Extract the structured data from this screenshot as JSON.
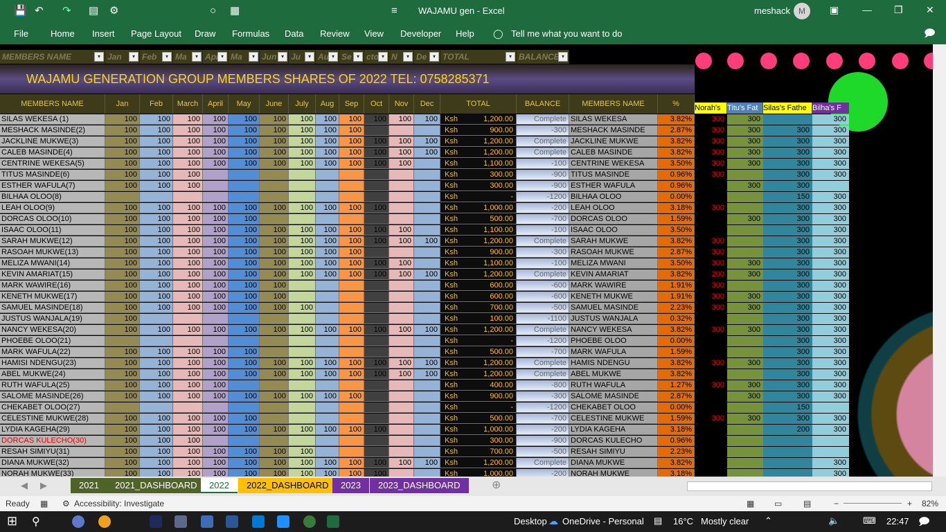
{
  "window": {
    "title": "WAJAMU gen  -  Excel",
    "user": "meshack",
    "avatar": "M"
  },
  "ribbon_tabs": [
    "File",
    "Home",
    "Insert",
    "Page Layout",
    "Draw",
    "Formulas",
    "Data",
    "Review",
    "View",
    "Developer",
    "Help",
    "Tell me what you want to do"
  ],
  "filter_headers": [
    "MEMBERS  NAME",
    "Jan",
    "Feb",
    "Ma",
    "Apr",
    "Ma",
    "Jun",
    "Ju",
    "Au",
    "Se",
    "cto",
    "N",
    "De",
    "TOTAL",
    "BALANCE"
  ],
  "banner": "WAJAMU GENERATION GROUP MEMBERS SHARES OF 2022  TEL: 0758285371",
  "col_headers": [
    "MEMBERS  NAME",
    "Jan",
    "Feb",
    "March",
    "April",
    "May",
    "June",
    "July",
    "Aug",
    "Sep",
    "Oct",
    "Nov",
    "Dec",
    "TOTAL",
    "BALANCE",
    "MEMBERS  NAME",
    "%",
    "Norah's",
    "Titu's Fat",
    "Silas's Fathe",
    "Bilha's F"
  ],
  "colors": {
    "ribbon": "#1e6c3e",
    "banner_text": "#ffd700",
    "dot": "#ff3c7c"
  },
  "rows": [
    {
      "n": "SILAS  WEKESA (1)",
      "m": [
        100,
        100,
        100,
        100,
        100,
        100,
        100,
        100,
        100,
        100,
        100,
        100
      ],
      "t": "1,200.00",
      "b": "Complete",
      "n2": "SILAS      WEKESA",
      "p": "3.82%",
      "x": [
        300,
        300,
        "",
        300
      ]
    },
    {
      "n": "MESHACK  MASINDE(2)",
      "m": [
        100,
        100,
        100,
        100,
        100,
        100,
        100,
        100,
        100,
        "",
        "",
        ""
      ],
      "t": "900.00",
      "b": "-300",
      "n2": "MESHACK   MASINDE",
      "p": "2.87%",
      "x": [
        300,
        300,
        300,
        300
      ]
    },
    {
      "n": "JACKLINE  MUKWE(3)",
      "m": [
        100,
        100,
        100,
        100,
        100,
        100,
        100,
        100,
        100,
        100,
        100,
        100
      ],
      "t": "1,200.00",
      "b": "Complete",
      "n2": "JACKLINE    MUKWE",
      "p": "3.82%",
      "x": [
        300,
        300,
        300,
        300
      ]
    },
    {
      "n": "CALEB   MASINDE(4)",
      "m": [
        100,
        100,
        100,
        100,
        100,
        100,
        100,
        100,
        100,
        100,
        100,
        100
      ],
      "t": "1,200.00",
      "b": "Complete",
      "n2": "CALEB    MASINDE",
      "p": "3.82%",
      "x": [
        300,
        300,
        300,
        300
      ]
    },
    {
      "n": "CENTRINE  WEKESA(5)",
      "m": [
        100,
        100,
        100,
        100,
        100,
        100,
        100,
        100,
        100,
        100,
        100,
        ""
      ],
      "t": "1,100.00",
      "b": "-100",
      "n2": "CENTRINE    WEKESA",
      "p": "3.50%",
      "x": [
        300,
        300,
        300,
        300
      ]
    },
    {
      "n": "TITUS  MASINDE(6)",
      "m": [
        100,
        100,
        100,
        "",
        "",
        "",
        "",
        "",
        "",
        "",
        "",
        ""
      ],
      "t": "300.00",
      "b": "-900",
      "n2": "TITUS          MASINDE",
      "p": "0.96%",
      "x": [
        300,
        "",
        300,
        300
      ]
    },
    {
      "n": "ESTHER  WAFULA(7)",
      "m": [
        100,
        100,
        100,
        "",
        "",
        "",
        "",
        "",
        "",
        "",
        "",
        ""
      ],
      "t": "300.00",
      "b": "-900",
      "n2": "ESTHER  WAFULA",
      "p": "0.96%",
      "x": [
        "",
        300,
        300,
        ""
      ]
    },
    {
      "n": "BILHAA OLOO(8)",
      "m": [
        "",
        "",
        "",
        "",
        "",
        "",
        "",
        "",
        "",
        "",
        "",
        ""
      ],
      "t": "-",
      "b": "-1200",
      "n2": "BILHAA    OLOO",
      "p": "0.00%",
      "x": [
        "",
        "",
        150,
        300
      ]
    },
    {
      "n": "LEAH OLOO(9)",
      "m": [
        100,
        100,
        100,
        100,
        100,
        100,
        100,
        100,
        100,
        100,
        "",
        ""
      ],
      "t": "1,000.00",
      "b": "-200",
      "n2": "LEAH        OLOO",
      "p": "3.18%",
      "x": [
        300,
        "",
        300,
        300
      ]
    },
    {
      "n": "DORCAS OLOO(10)",
      "m": [
        100,
        100,
        100,
        100,
        100,
        "",
        "",
        "",
        "",
        "",
        "",
        ""
      ],
      "t": "500.00",
      "b": "-700",
      "n2": "DORCAS    OLOO",
      "p": "1.59%",
      "x": [
        "",
        300,
        300,
        300
      ]
    },
    {
      "n": "ISAAC OLOO(11)",
      "m": [
        100,
        100,
        100,
        100,
        100,
        100,
        100,
        100,
        100,
        100,
        100,
        ""
      ],
      "t": "1,100.00",
      "b": "-100",
      "n2": "ISAAC     OLOO",
      "p": "3.50%",
      "x": [
        "",
        "",
        300,
        300
      ]
    },
    {
      "n": "SARAH  MUKWE(12)",
      "m": [
        100,
        100,
        100,
        100,
        100,
        100,
        100,
        100,
        100,
        100,
        100,
        100
      ],
      "t": "1,200.00",
      "b": "Complete",
      "n2": "SARAH     MUKWE",
      "p": "3.82%",
      "x": [
        300,
        "",
        300,
        300
      ]
    },
    {
      "n": "RASOAH MUKWE(13)",
      "m": [
        100,
        100,
        100,
        100,
        100,
        100,
        100,
        100,
        100,
        "",
        "",
        ""
      ],
      "t": "900.00",
      "b": "-300",
      "n2": "RASOAH     MUKWE",
      "p": "2.87%",
      "x": [
        300,
        "",
        300,
        300
      ]
    },
    {
      "n": "MELIZA MWANI(14)",
      "m": [
        100,
        100,
        100,
        100,
        100,
        100,
        100,
        100,
        100,
        100,
        100,
        ""
      ],
      "t": "1,100.00",
      "b": "-100",
      "n2": "MELIZA      MWANI",
      "p": "3.50%",
      "x": [
        300,
        300,
        300,
        300
      ]
    },
    {
      "n": "KEVIN AMARIAT(15)",
      "m": [
        100,
        100,
        100,
        100,
        100,
        100,
        100,
        100,
        100,
        100,
        100,
        100
      ],
      "t": "1,200.00",
      "b": "Complete",
      "n2": "KEVIN      AMARIAT",
      "p": "3.82%",
      "x": [
        200,
        300,
        300,
        300
      ]
    },
    {
      "n": "MARK  WAWIRE(16)",
      "m": [
        100,
        100,
        100,
        100,
        100,
        100,
        "",
        "",
        "",
        "",
        "",
        ""
      ],
      "t": "600.00",
      "b": "-600",
      "n2": "MARK      WAWIRE",
      "p": "1.91%",
      "x": [
        300,
        "",
        300,
        300
      ]
    },
    {
      "n": "KENETH  MUKWE(17)",
      "m": [
        100,
        100,
        100,
        100,
        100,
        100,
        "",
        "",
        "",
        "",
        "",
        ""
      ],
      "t": "600.00",
      "b": "-600",
      "n2": "KENETH      MUKWE",
      "p": "1.91%",
      "x": [
        300,
        300,
        300,
        300
      ]
    },
    {
      "n": "SAMUEL MASINDE(18)",
      "m": [
        100,
        100,
        100,
        100,
        100,
        100,
        100,
        "",
        "",
        "",
        "",
        ""
      ],
      "t": "700.00",
      "b": "-500",
      "n2": "SAMUEL     MASINDE",
      "p": "2.23%",
      "x": [
        300,
        300,
        300,
        300
      ]
    },
    {
      "n": "JUSTUS  WANJALA(19)",
      "m": [
        100,
        "",
        "",
        "",
        "",
        "",
        "",
        "",
        "",
        "",
        "",
        ""
      ],
      "t": "100.00",
      "b": "-1100",
      "n2": "JUSTUS  WANJALA",
      "p": "0.32%",
      "x": [
        "",
        "",
        300,
        300
      ]
    },
    {
      "n": "NANCY  WEKESA(20)",
      "m": [
        100,
        100,
        100,
        100,
        100,
        100,
        100,
        100,
        100,
        100,
        100,
        100
      ],
      "t": "1,200.00",
      "b": "Complete",
      "n2": "NANCY  WEKESA",
      "p": "3.82%",
      "x": [
        300,
        300,
        300,
        300
      ]
    },
    {
      "n": "PHOEBE  OLOO(21)",
      "m": [
        "",
        "",
        "",
        "",
        "",
        "",
        "",
        "",
        "",
        "",
        "",
        ""
      ],
      "t": "-",
      "b": "-1200",
      "n2": "PHOEBE  OLOO",
      "p": "0.00%",
      "x": [
        "",
        "",
        300,
        300
      ]
    },
    {
      "n": "MARK   WAFULA(22)",
      "m": [
        100,
        100,
        100,
        100,
        100,
        "",
        "",
        "",
        "",
        "",
        "",
        ""
      ],
      "t": "500.00",
      "b": "-700",
      "n2": "MARK  WAFULA",
      "p": "1.59%",
      "x": [
        "",
        "",
        300,
        300
      ]
    },
    {
      "n": "HAMISI  NDENGU(23)",
      "m": [
        100,
        100,
        100,
        100,
        100,
        100,
        100,
        100,
        100,
        100,
        100,
        100
      ],
      "t": "1,200.00",
      "b": "Complete",
      "n2": "HAMIS  NDENGU",
      "p": "3.82%",
      "x": [
        300,
        300,
        300,
        300
      ]
    },
    {
      "n": "ABEL  MUKWE(24)",
      "m": [
        100,
        100,
        100,
        100,
        100,
        100,
        100,
        100,
        100,
        100,
        100,
        100
      ],
      "t": "1,200.00",
      "b": "Complete",
      "n2": "ABEL  MUKWE",
      "p": "3.82%",
      "x": [
        "",
        "",
        300,
        300
      ]
    },
    {
      "n": "RUTH   WAFULA(25)",
      "m": [
        100,
        100,
        100,
        100,
        "",
        "",
        "",
        "",
        "",
        "",
        "",
        ""
      ],
      "t": "400.00",
      "b": "-800",
      "n2": "RUTH   WAFULA",
      "p": "1.27%",
      "x": [
        300,
        300,
        300,
        300
      ]
    },
    {
      "n": "SALOME  MASINDE(26)",
      "m": [
        100,
        100,
        100,
        100,
        100,
        100,
        100,
        100,
        100,
        "",
        "",
        ""
      ],
      "t": "900.00",
      "b": "-300",
      "n2": "SALOME  MASINDE",
      "p": "2.87%",
      "x": [
        "",
        300,
        300,
        300
      ]
    },
    {
      "n": "CHEKABET  OLOO(27)",
      "m": [
        "",
        "",
        "",
        "",
        "",
        "",
        "",
        "",
        "",
        "",
        "",
        ""
      ],
      "t": "-",
      "b": "-1200",
      "n2": "CHEKABET  OLOO",
      "p": "0.00%",
      "x": [
        "",
        "",
        150,
        ""
      ]
    },
    {
      "n": "CELESTINE  MUKWE(28)",
      "m": [
        100,
        100,
        100,
        100,
        100,
        "",
        "",
        "",
        "",
        "",
        "",
        ""
      ],
      "t": "500.00",
      "b": "-700",
      "n2": "CELESTINE  MUKWE",
      "p": "1.59%",
      "x": [
        300,
        300,
        300,
        300
      ]
    },
    {
      "n": "LYDIA  KAGEHA(29)",
      "m": [
        100,
        100,
        100,
        100,
        100,
        100,
        100,
        100,
        100,
        100,
        "",
        ""
      ],
      "t": "1,000.00",
      "b": "-200",
      "n2": "LYDIA  KAGEHA",
      "p": "3.18%",
      "x": [
        "",
        "",
        200,
        300
      ]
    },
    {
      "n": "DORCAS  KULECHO(30)",
      "m": [
        100,
        100,
        100,
        "",
        "",
        "",
        "",
        "",
        "",
        "",
        "",
        ""
      ],
      "t": "300.00",
      "b": "-900",
      "n2": "DORCAS  KULECHO",
      "p": "0.96%",
      "x": [
        "",
        "",
        "",
        ""
      ],
      "red": true
    },
    {
      "n": "RESAH  SIMIYU(31)",
      "m": [
        100,
        100,
        100,
        100,
        100,
        100,
        100,
        "",
        "",
        "",
        "",
        ""
      ],
      "t": "700.00",
      "b": "-500",
      "n2": "RESAH  SIMIYU",
      "p": "2.23%",
      "x": [
        "",
        "",
        "",
        ""
      ]
    },
    {
      "n": "DIANA  MUKWE(32)",
      "m": [
        100,
        100,
        100,
        100,
        100,
        100,
        100,
        100,
        100,
        100,
        100,
        100
      ],
      "t": "1,200.00",
      "b": "Complete",
      "n2": "DIANA  MUKWE",
      "p": "3.82%",
      "x": [
        "",
        "",
        "",
        300
      ]
    },
    {
      "n": "NORAH  MUKWE(33)",
      "m": [
        100,
        100,
        100,
        100,
        100,
        100,
        100,
        100,
        100,
        100,
        "",
        ""
      ],
      "t": "1,000.00",
      "b": "-200",
      "n2": "NORAH  MUKWE",
      "p": "3.18%",
      "x": [
        "",
        "",
        "",
        300
      ]
    }
  ],
  "currency": "Ksh",
  "sheet_tabs": [
    "2021",
    "2021_DASHBOARD",
    "2022",
    "2022_DASHBOARD",
    "2023",
    "2023_DASHBOARD"
  ],
  "status": {
    "ready": "Ready",
    "accessibility": "Accessibility: Investigate",
    "zoom": "82%"
  },
  "taskbar": {
    "desktop": "Desktop",
    "onedrive": "OneDrive - Personal",
    "weather_temp": "16°C",
    "weather": "Mostly clear",
    "time": "22:47"
  }
}
